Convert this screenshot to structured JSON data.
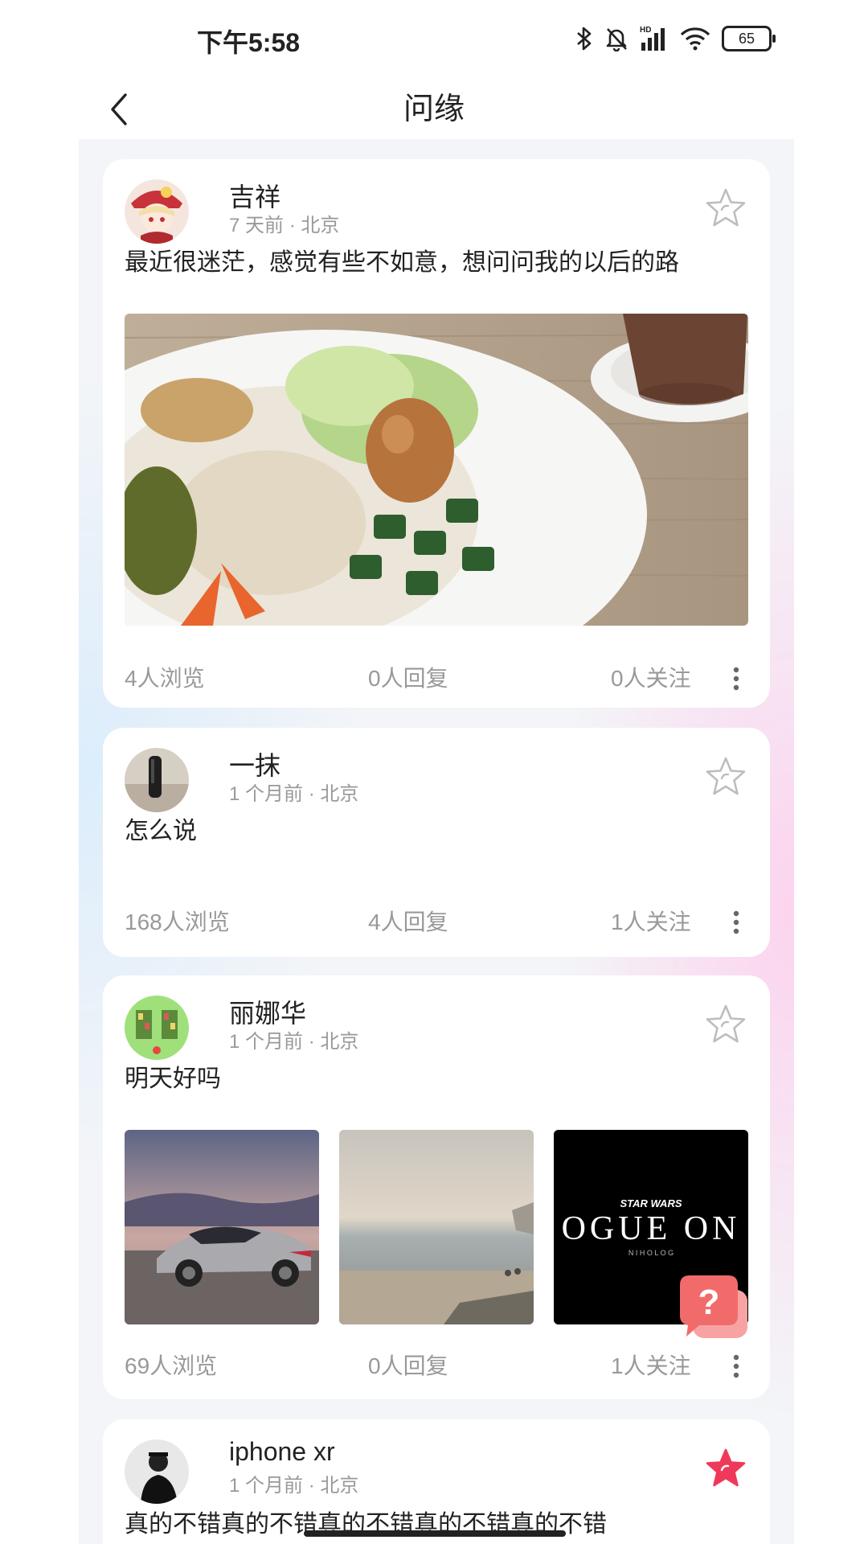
{
  "status": {
    "time": "下午5:58",
    "battery": "65"
  },
  "header": {
    "title": "问缘"
  },
  "posts": [
    {
      "user": "吉祥",
      "time": "7 天前",
      "location": "北京",
      "text": "最近很迷茫，感觉有些不如意，想问问我的以后的路",
      "views": "4人浏览",
      "replies": "0人回复",
      "follows": "0人关注",
      "starred": false
    },
    {
      "user": "一抹",
      "time": "1 个月前",
      "location": "北京",
      "text": "怎么说",
      "views": "168人浏览",
      "replies": "4人回复",
      "follows": "1人关注",
      "starred": false
    },
    {
      "user": "丽娜华",
      "time": "1 个月前",
      "location": "北京",
      "text": "明天好吗",
      "views": "69人浏览",
      "replies": "0人回复",
      "follows": "1人关注",
      "starred": false,
      "image3_text": {
        "brand": "STAR WARS",
        "title": "OGUE ON",
        "sub": "N I H O L O G"
      }
    },
    {
      "user": "iphone xr",
      "time": "1 个月前",
      "location": "北京",
      "text": "真的不错真的不错真的不错真的不错真的不错",
      "starred": true
    }
  ],
  "fab": {
    "glyph": "?"
  },
  "colors": {
    "accent": "#f0385a",
    "muted": "#999999",
    "fab": "#f26b6b"
  }
}
